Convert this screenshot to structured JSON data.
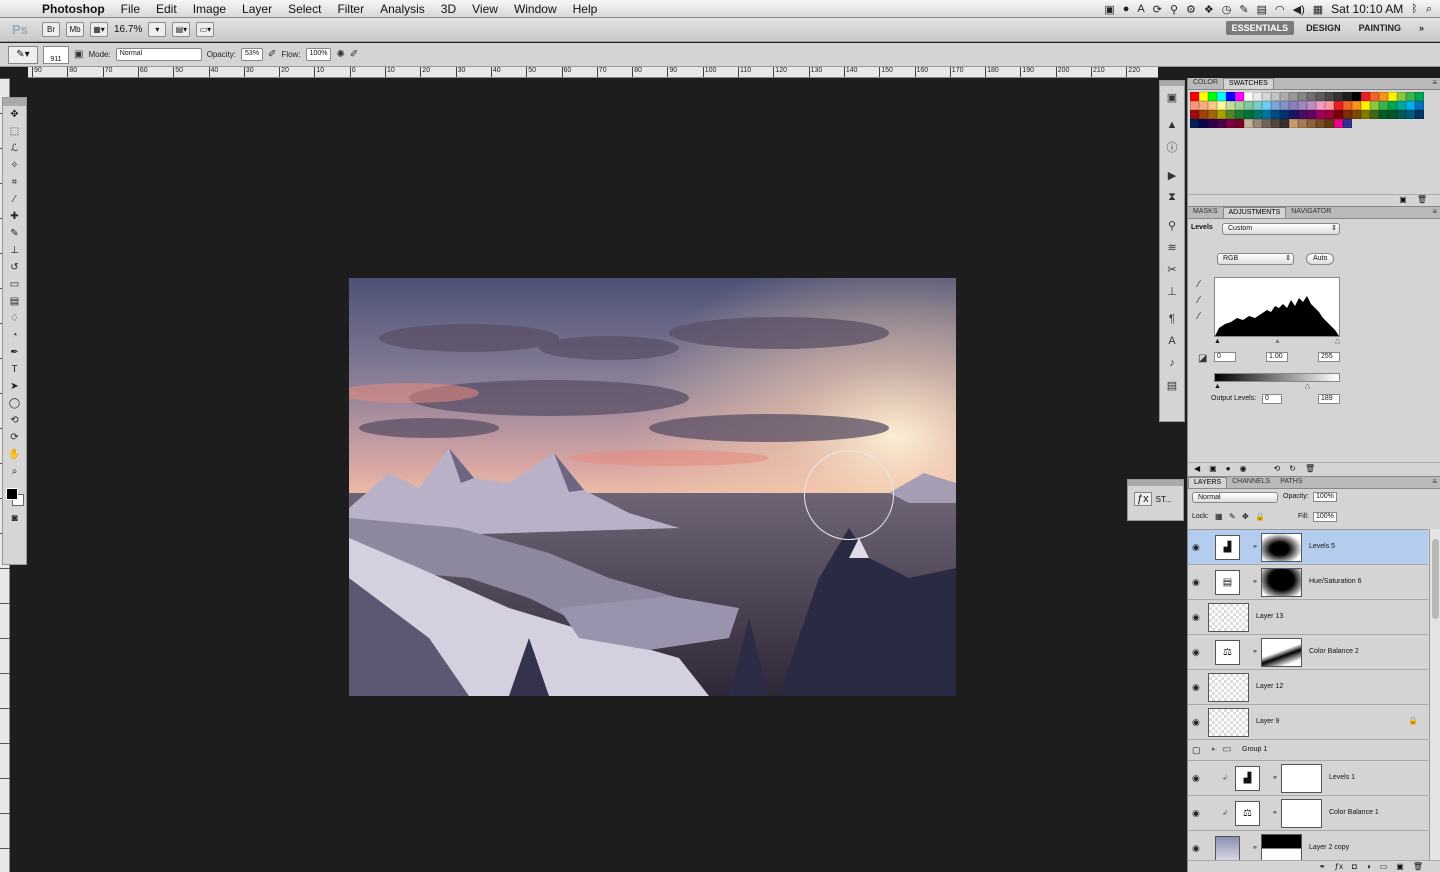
{
  "menubar": {
    "app_name": "Photoshop",
    "items": [
      "File",
      "Edit",
      "Image",
      "Layer",
      "Select",
      "Filter",
      "Analysis",
      "3D",
      "View",
      "Window",
      "Help"
    ],
    "clock": "Sat 10:10 AM"
  },
  "appbar": {
    "logo": "Ps",
    "bridge": "Br",
    "minibridge": "Mb",
    "zoom": "16.7%",
    "workspaces": [
      "ESSENTIALS",
      "DESIGN",
      "PAINTING"
    ],
    "more": "»"
  },
  "options": {
    "brush_size": "911",
    "mode_label": "Mode:",
    "mode_value": "Normal",
    "opacity_label": "Opacity:",
    "opacity_value": "53%",
    "flow_label": "Flow:",
    "flow_value": "100%"
  },
  "ruler_top": [
    "90",
    "80",
    "70",
    "60",
    "50",
    "40",
    "30",
    "20",
    "10",
    "0",
    "10",
    "20",
    "30",
    "40",
    "50",
    "60",
    "70",
    "80",
    "90",
    "100",
    "110",
    "120",
    "130",
    "140",
    "150",
    "160",
    "170",
    "180",
    "190",
    "200",
    "210",
    "220"
  ],
  "swatches": {
    "tabs": [
      "COLOR",
      "SWATCHES"
    ],
    "active": "SWATCHES",
    "colors": [
      "#ff0000",
      "#ffff00",
      "#00ff00",
      "#00ffff",
      "#0000ff",
      "#ff00ff",
      "#ffffff",
      "#ebebeb",
      "#d6d6d6",
      "#c2c2c2",
      "#adadad",
      "#999999",
      "#858585",
      "#707070",
      "#5c5c5c",
      "#474747",
      "#333333",
      "#1f1f1f",
      "#000000",
      "#ee1d24",
      "#f26522",
      "#f7941d",
      "#fff200",
      "#8dc63f",
      "#39b54a",
      "#00a651",
      "#f7977a",
      "#f9ad81",
      "#fdc68a",
      "#fff79a",
      "#c4df9b",
      "#a3d39c",
      "#82ca9d",
      "#7bcdc8",
      "#6ecff6",
      "#7ea7d8",
      "#8493ca",
      "#8882be",
      "#a187be",
      "#bc8dbf",
      "#f49ac2",
      "#f6989d",
      "#ed1c24",
      "#f26522",
      "#f7941d",
      "#fff200",
      "#8dc63f",
      "#39b54a",
      "#00a651",
      "#00a99d",
      "#00aeef",
      "#0072bc",
      "#9e0b0f",
      "#a0410d",
      "#a36209",
      "#aba000",
      "#598527",
      "#1a7b30",
      "#007236",
      "#00746b",
      "#0076a3",
      "#004b80",
      "#003471",
      "#1b1464",
      "#440e62",
      "#630460",
      "#9e005d",
      "#9e0039",
      "#790000",
      "#7b2e00",
      "#7d4900",
      "#827b00",
      "#406618",
      "#005e20",
      "#005826",
      "#005952",
      "#005b7f",
      "#003663",
      "#002157",
      "#0d004c",
      "#32004b",
      "#4b0049",
      "#7b0046",
      "#7a0026",
      "#c7b299",
      "#998675",
      "#736357",
      "#534741",
      "#37302d",
      "#c69c6d",
      "#a67c52",
      "#8c6239",
      "#754c24",
      "#603913",
      "#ec008c",
      "#2e3192"
    ]
  },
  "adjustments": {
    "tabs": [
      "MASKS",
      "ADJUSTMENTS",
      "NAVIGATOR"
    ],
    "active": "ADJUSTMENTS",
    "title": "Levels",
    "preset": "Custom",
    "channel": "RGB",
    "auto": "Auto",
    "input_black": "0",
    "input_gamma": "1.00",
    "input_white": "255",
    "output_label": "Output Levels:",
    "output_black": "0",
    "output_white": "189"
  },
  "layers_panel": {
    "tabs": [
      "LAYERS",
      "CHANNELS",
      "PATHS"
    ],
    "active": "LAYERS",
    "blend": "Normal",
    "opacity_label": "Opacity:",
    "opacity": "100%",
    "lock_label": "Lock:",
    "fill_label": "Fill:",
    "fill": "100%",
    "layers": [
      {
        "name": "Levels 5",
        "kind": "levels",
        "selected": true,
        "visible": true
      },
      {
        "name": "Hue/Saturation 6",
        "kind": "huesat",
        "selected": false,
        "visible": true
      },
      {
        "name": "Layer 13",
        "kind": "pixel",
        "selected": false,
        "visible": true
      },
      {
        "name": "Color Balance 2",
        "kind": "colorbalance",
        "selected": false,
        "visible": true
      },
      {
        "name": "Layer 12",
        "kind": "pixel",
        "selected": false,
        "visible": true
      },
      {
        "name": "Layer 9",
        "kind": "pixel",
        "selected": false,
        "visible": true,
        "locked": true
      },
      {
        "name": "Group 1",
        "kind": "group",
        "selected": false,
        "visible": false
      },
      {
        "name": "Levels 1",
        "kind": "levels",
        "selected": false,
        "visible": true,
        "clipped": true
      },
      {
        "name": "Color Balance 1",
        "kind": "colorbalance",
        "selected": false,
        "visible": true,
        "clipped": true
      },
      {
        "name": "Layer 2 copy",
        "kind": "photo",
        "selected": false,
        "visible": true
      }
    ]
  },
  "mini_panel": {
    "label": "ST..."
  },
  "icons": {
    "apple": "apple-icon",
    "eye": "eye-icon",
    "link": "chain-link-icon",
    "lock": "lock-icon"
  }
}
